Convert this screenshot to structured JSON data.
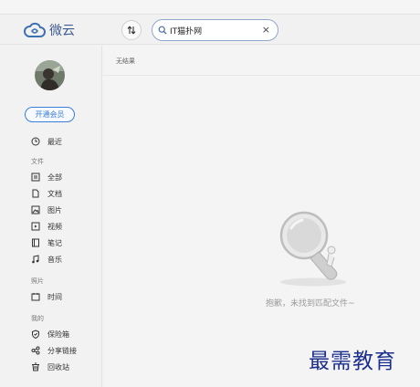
{
  "app": {
    "name": "微云"
  },
  "search": {
    "value": "IT猫扑网",
    "clear_glyph": "×"
  },
  "sidebar": {
    "vip_button": "开通会员",
    "recent": "最近",
    "sections": {
      "files": "文件",
      "photos": "照片",
      "mine": "我的"
    },
    "file_items": [
      {
        "label": "全部",
        "icon": "grid-icon"
      },
      {
        "label": "文档",
        "icon": "document-icon"
      },
      {
        "label": "图片",
        "icon": "image-icon"
      },
      {
        "label": "视频",
        "icon": "video-icon"
      },
      {
        "label": "笔记",
        "icon": "note-icon"
      },
      {
        "label": "音乐",
        "icon": "music-icon"
      }
    ],
    "photo_items": [
      {
        "label": "时间",
        "icon": "calendar-icon"
      }
    ],
    "mine_items": [
      {
        "label": "保险箱",
        "icon": "shield-icon"
      },
      {
        "label": "分享链接",
        "icon": "share-icon"
      },
      {
        "label": "回收站",
        "icon": "trash-icon"
      }
    ]
  },
  "main": {
    "no_result": "无结果",
    "empty_message": "抱歉，未找到匹配文件~"
  },
  "watermark": "最需教育",
  "colors": {
    "accent": "#3a7ed8",
    "logo": "#3d5c90",
    "watermark": "#1c2f8e"
  }
}
